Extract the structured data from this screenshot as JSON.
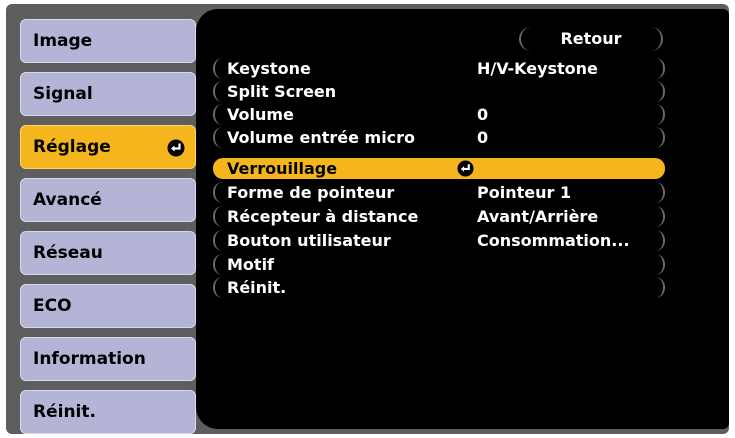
{
  "sidebar": {
    "items": [
      {
        "label": "Image",
        "active": false
      },
      {
        "label": "Signal",
        "active": false
      },
      {
        "label": "Réglage",
        "active": true
      },
      {
        "label": "Avancé",
        "active": false
      },
      {
        "label": "Réseau",
        "active": false
      },
      {
        "label": "ECO",
        "active": false
      },
      {
        "label": "Information",
        "active": false
      },
      {
        "label": "Réinit.",
        "active": false
      }
    ],
    "active_indicator_icon": "enter-icon"
  },
  "content": {
    "back_label": "Retour",
    "rows": [
      {
        "label": "Keystone",
        "value": "H/V-Keystone"
      },
      {
        "label": "Split Screen",
        "value": ""
      },
      {
        "label": "Volume",
        "value": "0"
      },
      {
        "label": "Volume entrée micro",
        "value": "0"
      },
      {
        "label": "Verrouillage",
        "value": "",
        "selected": true,
        "icon": "enter-icon"
      },
      {
        "label": "Forme de pointeur",
        "value": "Pointeur 1"
      },
      {
        "label": "Récepteur à distance",
        "value": "Avant/Arrière"
      },
      {
        "label": "Bouton utilisateur",
        "value": "Consommation..."
      },
      {
        "label": "Motif",
        "value": ""
      },
      {
        "label": "Réinit.",
        "value": ""
      }
    ]
  },
  "colors": {
    "frame": "#5e5e5e",
    "sidebar_item": "#b4b4d6",
    "highlight": "#f5b51c",
    "content_bg": "#000000",
    "text_light": "#ffffff"
  }
}
